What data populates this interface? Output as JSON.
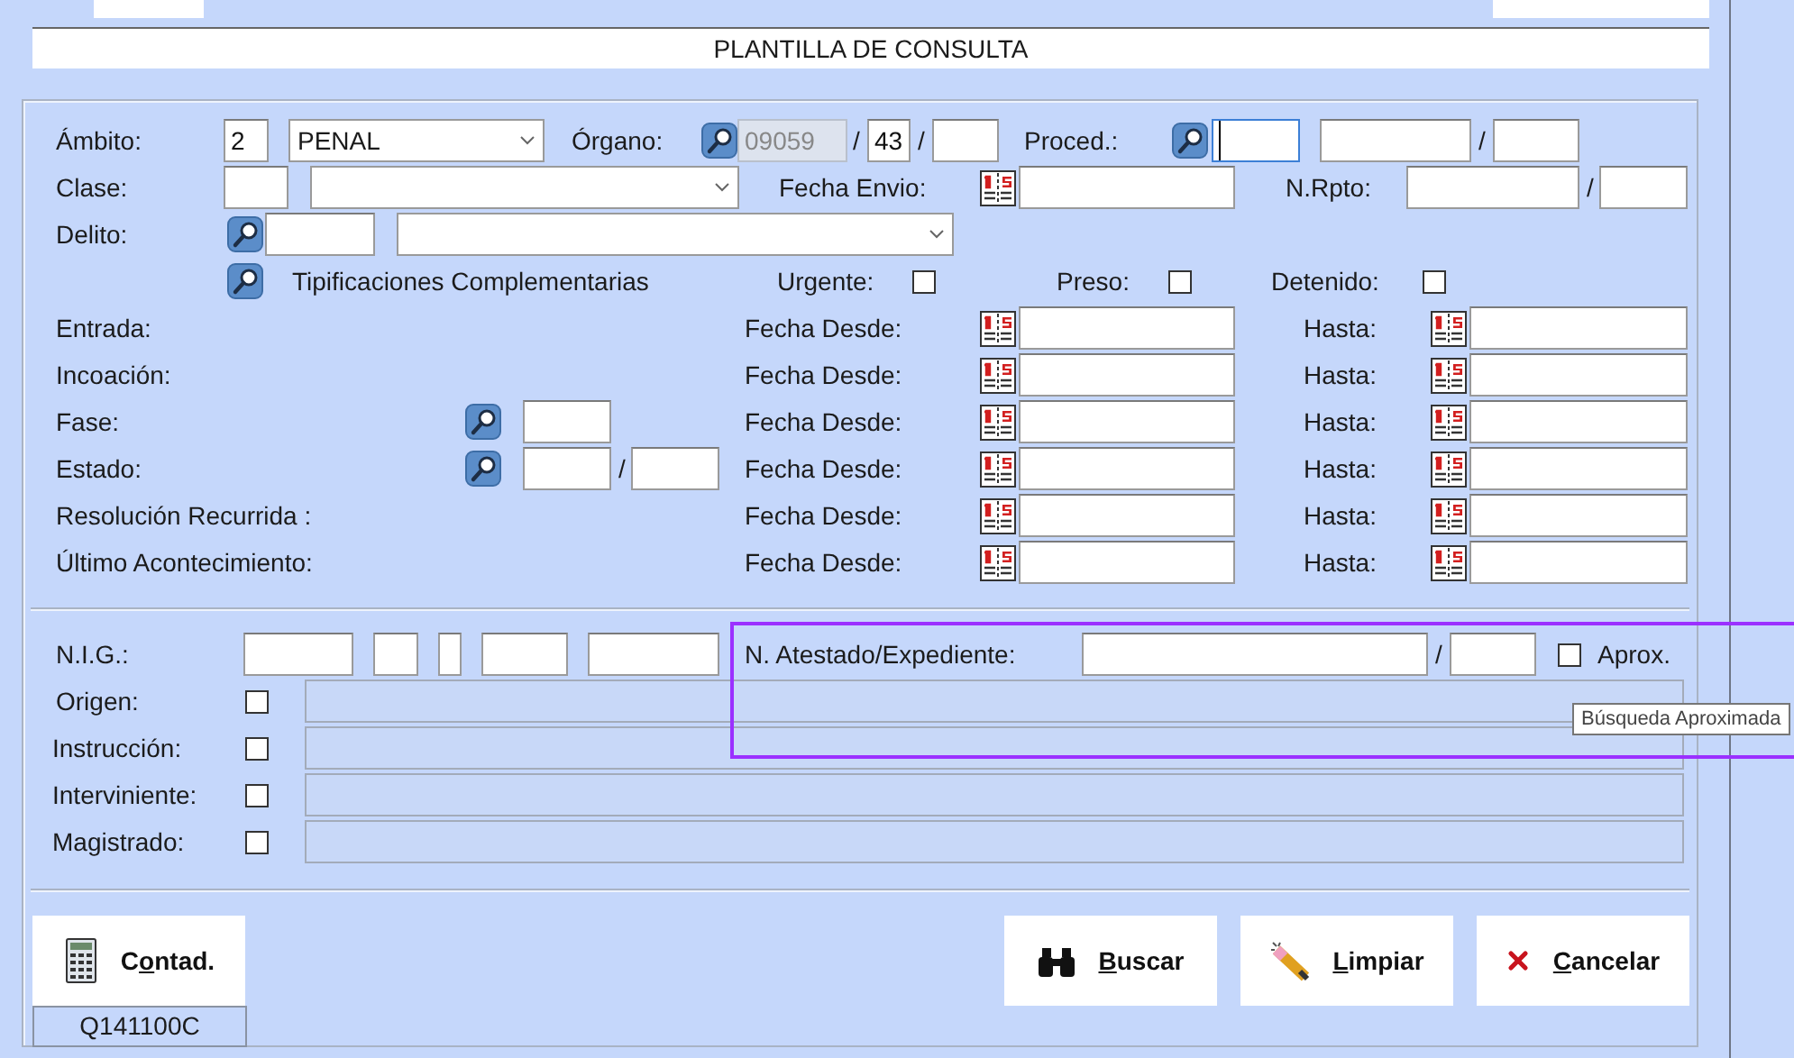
{
  "title": "PLANTILLA DE CONSULTA",
  "rows": [
    {
      "items": [
        {
          "kind": "label",
          "text": "Ámbito:"
        },
        {
          "kind": "field",
          "value": "2"
        },
        {
          "kind": "select",
          "value": "PENAL"
        },
        {
          "kind": "label",
          "text": "Órgano:"
        },
        {
          "kind": "lookup"
        },
        {
          "kind": "field",
          "value": "09059",
          "disabled": true
        },
        {
          "kind": "slash",
          "text": "/"
        },
        {
          "kind": "field",
          "value": "43"
        },
        {
          "kind": "slash",
          "text": "/"
        },
        {
          "kind": "field"
        },
        {
          "kind": "label",
          "text": "Proced.:"
        },
        {
          "kind": "lookup"
        },
        {
          "kind": "field",
          "focused": true
        },
        {
          "kind": "field"
        },
        {
          "kind": "slash",
          "text": "/"
        },
        {
          "kind": "field"
        }
      ]
    },
    {
      "items": [
        {
          "kind": "label",
          "text": "Clase:"
        },
        {
          "kind": "field"
        },
        {
          "kind": "select"
        },
        {
          "kind": "label",
          "text": "Fecha Envio:"
        },
        {
          "kind": "calendar"
        },
        {
          "kind": "field"
        },
        {
          "kind": "label",
          "text": "N.Rpto:"
        },
        {
          "kind": "field"
        },
        {
          "kind": "slash",
          "text": "/"
        },
        {
          "kind": "field"
        }
      ]
    },
    {
      "items": [
        {
          "kind": "label",
          "text": "Delito:"
        },
        {
          "kind": "lookup"
        },
        {
          "kind": "field"
        },
        {
          "kind": "select"
        }
      ]
    },
    {
      "items": [
        {
          "kind": "lookup"
        },
        {
          "kind": "label",
          "text": "Tipificaciones Complementarias"
        },
        {
          "kind": "label",
          "text": "Urgente:"
        },
        {
          "kind": "checkbox",
          "checked": false
        },
        {
          "kind": "label",
          "text": "Preso:"
        },
        {
          "kind": "checkbox",
          "checked": false
        },
        {
          "kind": "label",
          "text": "Detenido:"
        },
        {
          "kind": "checkbox",
          "checked": false
        }
      ]
    },
    {
      "items": [
        {
          "kind": "label",
          "text": "Entrada:"
        },
        {
          "kind": "label",
          "text": "Fecha Desde:"
        },
        {
          "kind": "calendar"
        },
        {
          "kind": "field"
        },
        {
          "kind": "label",
          "text": "Hasta:"
        },
        {
          "kind": "calendar"
        },
        {
          "kind": "field"
        }
      ]
    },
    {
      "items": [
        {
          "kind": "label",
          "text": "Incoación:"
        },
        {
          "kind": "label",
          "text": "Fecha Desde:"
        },
        {
          "kind": "calendar"
        },
        {
          "kind": "field"
        },
        {
          "kind": "label",
          "text": "Hasta:"
        },
        {
          "kind": "calendar"
        },
        {
          "kind": "field"
        }
      ]
    },
    {
      "items": [
        {
          "kind": "label",
          "text": "Fase:"
        },
        {
          "kind": "lookup"
        },
        {
          "kind": "field"
        },
        {
          "kind": "label",
          "text": "Fecha Desde:"
        },
        {
          "kind": "calendar"
        },
        {
          "kind": "field"
        },
        {
          "kind": "label",
          "text": "Hasta:"
        },
        {
          "kind": "calendar"
        },
        {
          "kind": "field"
        }
      ]
    },
    {
      "items": [
        {
          "kind": "label",
          "text": "Estado:"
        },
        {
          "kind": "lookup"
        },
        {
          "kind": "field"
        },
        {
          "kind": "slash",
          "text": "/"
        },
        {
          "kind": "field"
        },
        {
          "kind": "label",
          "text": "Fecha Desde:"
        },
        {
          "kind": "calendar"
        },
        {
          "kind": "field"
        },
        {
          "kind": "label",
          "text": "Hasta:"
        },
        {
          "kind": "calendar"
        },
        {
          "kind": "field"
        }
      ]
    },
    {
      "items": [
        {
          "kind": "label",
          "text": "Resolución Recurrida :"
        },
        {
          "kind": "label",
          "text": "Fecha Desde:"
        },
        {
          "kind": "calendar"
        },
        {
          "kind": "field"
        },
        {
          "kind": "label",
          "text": "Hasta:"
        },
        {
          "kind": "calendar"
        },
        {
          "kind": "field"
        }
      ]
    },
    {
      "items": [
        {
          "kind": "label",
          "text": "Último Acontecimiento:"
        },
        {
          "kind": "label",
          "text": "Fecha Desde:"
        },
        {
          "kind": "calendar"
        },
        {
          "kind": "field"
        },
        {
          "kind": "label",
          "text": "Hasta:"
        },
        {
          "kind": "calendar"
        },
        {
          "kind": "field"
        }
      ]
    },
    {
      "items": [
        {
          "kind": "label",
          "text": "N.I.G.:"
        },
        {
          "kind": "field"
        },
        {
          "kind": "field"
        },
        {
          "kind": "field"
        },
        {
          "kind": "field"
        },
        {
          "kind": "field"
        },
        {
          "kind": "label",
          "text": "N. Atestado/Expediente:"
        },
        {
          "kind": "field"
        },
        {
          "kind": "slash",
          "text": "/"
        },
        {
          "kind": "field"
        },
        {
          "kind": "checkbox",
          "checked": false
        },
        {
          "kind": "label",
          "text": "Aprox."
        }
      ]
    },
    {
      "items": [
        {
          "kind": "label",
          "text": "Origen:"
        },
        {
          "kind": "checkbox",
          "checked": false
        },
        {
          "kind": "field",
          "disabled": true
        }
      ]
    },
    {
      "items": [
        {
          "kind": "label",
          "text": "Instrucción:"
        },
        {
          "kind": "checkbox",
          "checked": false
        },
        {
          "kind": "field",
          "disabled": true
        }
      ]
    },
    {
      "items": [
        {
          "kind": "label",
          "text": "Interviniente:"
        },
        {
          "kind": "checkbox",
          "checked": false
        },
        {
          "kind": "field",
          "disabled": true
        }
      ]
    },
    {
      "items": [
        {
          "kind": "label",
          "text": "Magistrado:"
        },
        {
          "kind": "checkbox",
          "checked": false
        },
        {
          "kind": "field",
          "disabled": true
        }
      ]
    }
  ],
  "tooltip": "Búsqueda Aproximada",
  "buttons": [
    {
      "kind": "calculator",
      "before": "C",
      "key": "o",
      "after": "ntad."
    },
    {
      "kind": "binoculars",
      "key": "B",
      "after": "uscar"
    },
    {
      "kind": "wand",
      "key": "L",
      "after": "impiar"
    },
    {
      "kind": "cross",
      "key": "C",
      "after": "ancelar"
    }
  ],
  "status": "Q141100C"
}
